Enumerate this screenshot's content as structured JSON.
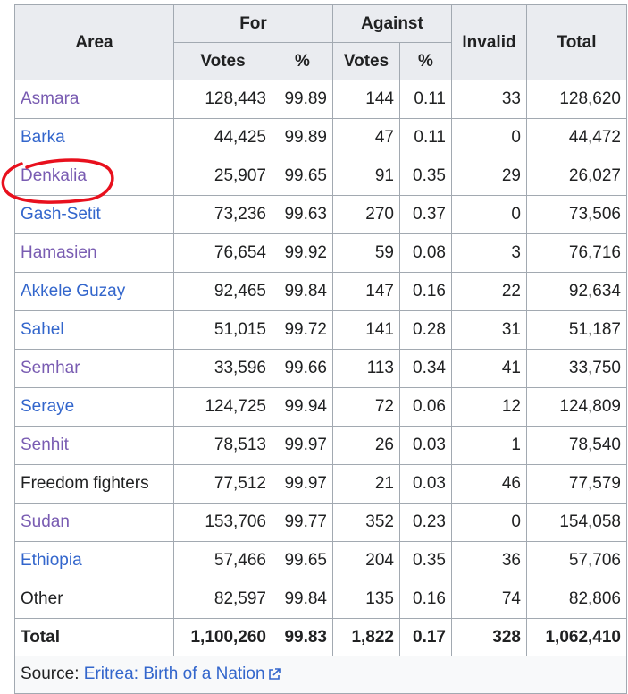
{
  "headers": {
    "area": "Area",
    "for": "For",
    "against": "Against",
    "invalid": "Invalid",
    "total": "Total",
    "votes": "Votes",
    "pct": "%"
  },
  "rows": [
    {
      "area": "Asmara",
      "for_votes": "128,443",
      "for_pct": "99.89",
      "against_votes": "144",
      "against_pct": "0.11",
      "invalid": "33",
      "total": "128,620",
      "link_style": "visited"
    },
    {
      "area": "Barka",
      "for_votes": "44,425",
      "for_pct": "99.89",
      "against_votes": "47",
      "against_pct": "0.11",
      "invalid": "0",
      "total": "44,472",
      "link_style": "link"
    },
    {
      "area": "Denkalia",
      "for_votes": "25,907",
      "for_pct": "99.65",
      "against_votes": "91",
      "against_pct": "0.35",
      "invalid": "29",
      "total": "26,027",
      "link_style": "visited"
    },
    {
      "area": "Gash-Setit",
      "for_votes": "73,236",
      "for_pct": "99.63",
      "against_votes": "270",
      "against_pct": "0.37",
      "invalid": "0",
      "total": "73,506",
      "link_style": "link"
    },
    {
      "area": "Hamasien",
      "for_votes": "76,654",
      "for_pct": "99.92",
      "against_votes": "59",
      "against_pct": "0.08",
      "invalid": "3",
      "total": "76,716",
      "link_style": "visited"
    },
    {
      "area": "Akkele Guzay",
      "for_votes": "92,465",
      "for_pct": "99.84",
      "against_votes": "147",
      "against_pct": "0.16",
      "invalid": "22",
      "total": "92,634",
      "link_style": "link"
    },
    {
      "area": "Sahel",
      "for_votes": "51,015",
      "for_pct": "99.72",
      "against_votes": "141",
      "against_pct": "0.28",
      "invalid": "31",
      "total": "51,187",
      "link_style": "link"
    },
    {
      "area": "Semhar",
      "for_votes": "33,596",
      "for_pct": "99.66",
      "against_votes": "113",
      "against_pct": "0.34",
      "invalid": "41",
      "total": "33,750",
      "link_style": "visited"
    },
    {
      "area": "Seraye",
      "for_votes": "124,725",
      "for_pct": "99.94",
      "against_votes": "72",
      "against_pct": "0.06",
      "invalid": "12",
      "total": "124,809",
      "link_style": "link"
    },
    {
      "area": "Senhit",
      "for_votes": "78,513",
      "for_pct": "99.97",
      "against_votes": "26",
      "against_pct": "0.03",
      "invalid": "1",
      "total": "78,540",
      "link_style": "visited"
    },
    {
      "area": "Freedom fighters",
      "for_votes": "77,512",
      "for_pct": "99.97",
      "against_votes": "21",
      "against_pct": "0.03",
      "invalid": "46",
      "total": "77,579",
      "link_style": "none"
    },
    {
      "area": "Sudan",
      "for_votes": "153,706",
      "for_pct": "99.77",
      "against_votes": "352",
      "against_pct": "0.23",
      "invalid": "0",
      "total": "154,058",
      "link_style": "visited"
    },
    {
      "area": "Ethiopia",
      "for_votes": "57,466",
      "for_pct": "99.65",
      "against_votes": "204",
      "against_pct": "0.35",
      "invalid": "36",
      "total": "57,706",
      "link_style": "link"
    },
    {
      "area": "Other",
      "for_votes": "82,597",
      "for_pct": "99.84",
      "against_votes": "135",
      "against_pct": "0.16",
      "invalid": "74",
      "total": "82,806",
      "link_style": "none"
    }
  ],
  "totals": {
    "label": "Total",
    "for_votes": "1,100,260",
    "for_pct": "99.83",
    "against_votes": "1,822",
    "against_pct": "0.17",
    "invalid": "328",
    "total": "1,062,410"
  },
  "source": {
    "label": "Source: ",
    "link_text": "Eritrea: Birth of a Nation"
  },
  "colors": {
    "visited_link": "#795cb2",
    "link": "#3366cc",
    "header_bg": "#eaecf0",
    "border": "#a2a9b1",
    "annotation": "#e8101d"
  }
}
